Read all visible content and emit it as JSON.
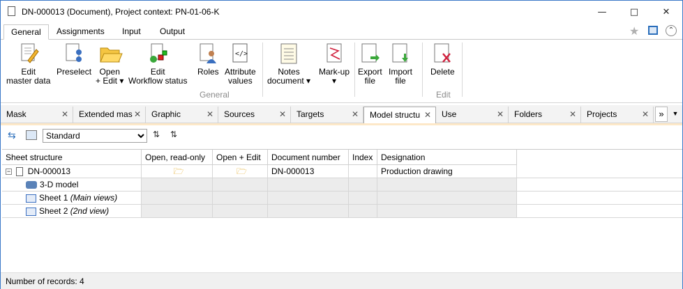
{
  "window": {
    "title": "DN-000013 (Document), Project context: PN-01-06-K"
  },
  "ribbon_tabs": [
    "General",
    "Assignments",
    "Input",
    "Output"
  ],
  "ribbon": {
    "buttons": {
      "edit_master": "Edit\nmaster data",
      "preselect": "Preselect",
      "open_edit": "Open\n+ Edit ▾",
      "edit_workflow": "Edit\nWorkflow status",
      "roles": "Roles",
      "attr_values": "Attribute\nvalues",
      "notes": "Notes\ndocument ▾",
      "markup": "Mark-up\n▾",
      "export": "Export\nfile",
      "import": "Import\nfile",
      "delete": "Delete"
    },
    "groups": {
      "general": "General",
      "edit": "Edit"
    }
  },
  "doc_tabs": [
    "Mask",
    "Extended mas",
    "Graphic",
    "Sources",
    "Targets",
    "Model structu",
    "Use",
    "Folders",
    "Projects"
  ],
  "view_select": {
    "value": "Standard"
  },
  "grid": {
    "headers": [
      "Sheet structure",
      "Open, read-only",
      "Open + Edit",
      "Document number",
      "Index",
      "Designation"
    ],
    "rows": [
      {
        "name": "DN-000013",
        "number": "DN-000013",
        "designation": "Production drawing"
      },
      {
        "name": "3-D model"
      },
      {
        "name": "Sheet 1",
        "note": "(Main views)"
      },
      {
        "name": "Sheet 2",
        "note": "(2nd view)"
      }
    ]
  },
  "status": {
    "records": "Number of records: 4"
  }
}
